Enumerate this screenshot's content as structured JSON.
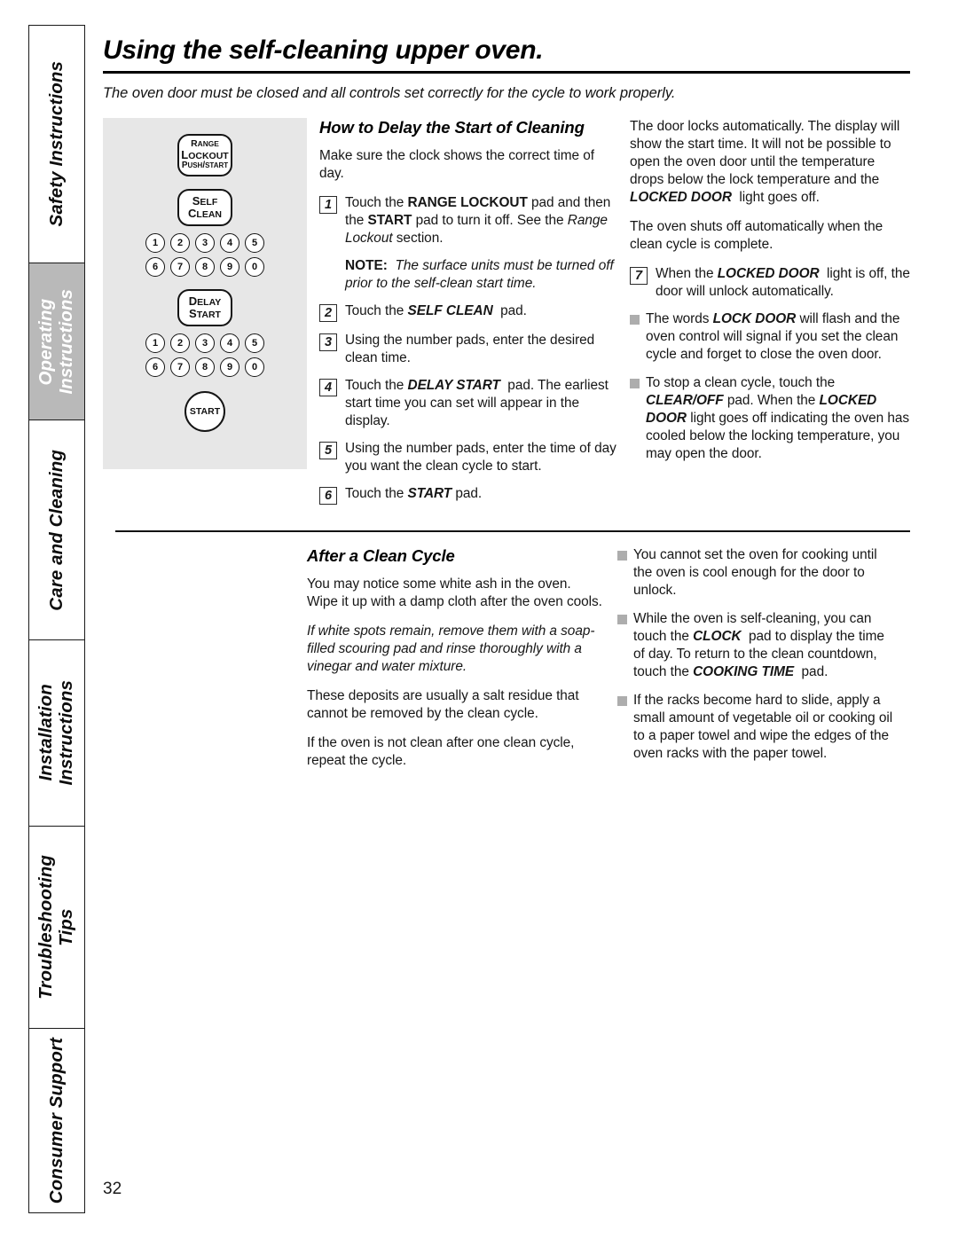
{
  "sidebar": {
    "tabs": [
      {
        "label": "Safety Instructions",
        "active": false
      },
      {
        "label": "Operating\nInstructions",
        "active": true
      },
      {
        "label": "Care and Cleaning",
        "active": false
      },
      {
        "label": "Installation\nInstructions",
        "active": false
      },
      {
        "label": "Troubleshooting\nTips",
        "active": false
      },
      {
        "label": "Consumer Support",
        "active": false
      }
    ]
  },
  "page": {
    "title": "Using the self-cleaning upper oven.",
    "subtitle": "The oven door must be closed and all controls set correctly for the cycle to work properly.",
    "number": "32"
  },
  "control_panel": {
    "range_lockout": {
      "line1": "RANGE",
      "line2": "LOCKOUT",
      "line3": "PUSH/START"
    },
    "self_clean": {
      "line1": "SELF",
      "line2": "CLEAN"
    },
    "delay_start": {
      "line1": "DELAY",
      "line2": "START"
    },
    "start": "START",
    "keypad_rows": [
      [
        "1",
        "2",
        "3",
        "4",
        "5"
      ],
      [
        "6",
        "7",
        "8",
        "9",
        "0"
      ]
    ]
  },
  "section_delay": {
    "heading": "How to Delay the Start of Cleaning",
    "intro": "Make sure the clock shows the correct time of day.",
    "steps": [
      {
        "num": "1",
        "html": "Touch the <b>RANGE LOCKOUT</b> pad and then the <b>START</b> pad to turn it off. See the <span class=\"it\">Range Lockout</span> section."
      },
      {
        "num": "2",
        "html": "Touch the <span class=\"bi\">SELF CLEAN</span>&nbsp; pad."
      },
      {
        "num": "3",
        "html": "Using the number pads, enter the desired clean time."
      },
      {
        "num": "4",
        "html": "Touch the <span class=\"bi\">DELAY START</span>&nbsp; pad. The earliest start time you can set will appear in the display."
      },
      {
        "num": "5",
        "html": "Using the number pads, enter the time of day you want the clean cycle to start."
      },
      {
        "num": "6",
        "html": "Touch the <span class=\"bi\">START</span> pad."
      }
    ],
    "note": "<b>NOTE:</b>&nbsp; The surface units must be turned off prior to the self-clean start time.",
    "right_paras": [
      "The door locks automatically. The display will show the start time. It will not be possible to open the oven door until the temperature drops below the lock temperature and the <span class=\"bi\">LOCKED DOOR</span>&nbsp; light goes off.",
      "The oven shuts off automatically when the clean cycle is complete."
    ],
    "right_step": {
      "num": "7",
      "html": "When the <span class=\"bi\">LOCKED DOOR</span>&nbsp; light is off, the door will unlock automatically."
    },
    "right_bullets": [
      "The words <span class=\"bi\">LOCK DOOR</span> will flash and the oven control will signal if you set the clean cycle and forget to close the oven door.",
      "To stop a clean cycle, touch the <span class=\"bi\">CLEAR/OFF</span> pad. When the <span class=\"bi\">LOCKED DOOR</span> light goes off indicating the oven has cooled below the locking temperature, you may open the door."
    ]
  },
  "section_after": {
    "heading": "After a Clean Cycle",
    "left_paras": [
      {
        "text": "You may notice some white ash in the oven. Wipe it up with a damp cloth after the oven cools.",
        "italic": false
      },
      {
        "text": "If white spots remain, remove them with a soap-filled scouring pad and rinse thoroughly with a vinegar and water mixture.",
        "italic": true
      },
      {
        "text": "These deposits are usually a salt residue that cannot be removed by the clean cycle.",
        "italic": false
      },
      {
        "text": "If the oven is not clean after one clean cycle, repeat the cycle.",
        "italic": false
      }
    ],
    "right_bullets": [
      "You cannot set the oven for cooking until the oven is cool enough for the door to unlock.",
      "While the oven is self-cleaning, you can touch the <span class=\"bi\">CLOCK</span>&nbsp; pad to display the time of day. To return to the clean countdown, touch the <span class=\"bi\">COOKING TIME</span>&nbsp; pad.",
      "If the racks become hard to slide, apply a small amount of vegetable oil or cooking oil to a paper towel and wipe the edges of the oven racks with the paper towel."
    ]
  },
  "colors": {
    "active_tab_bg": "#b9b9b9",
    "panel_bg": "#e7e7e7",
    "bullet": "#adadad",
    "text": "#161616"
  }
}
